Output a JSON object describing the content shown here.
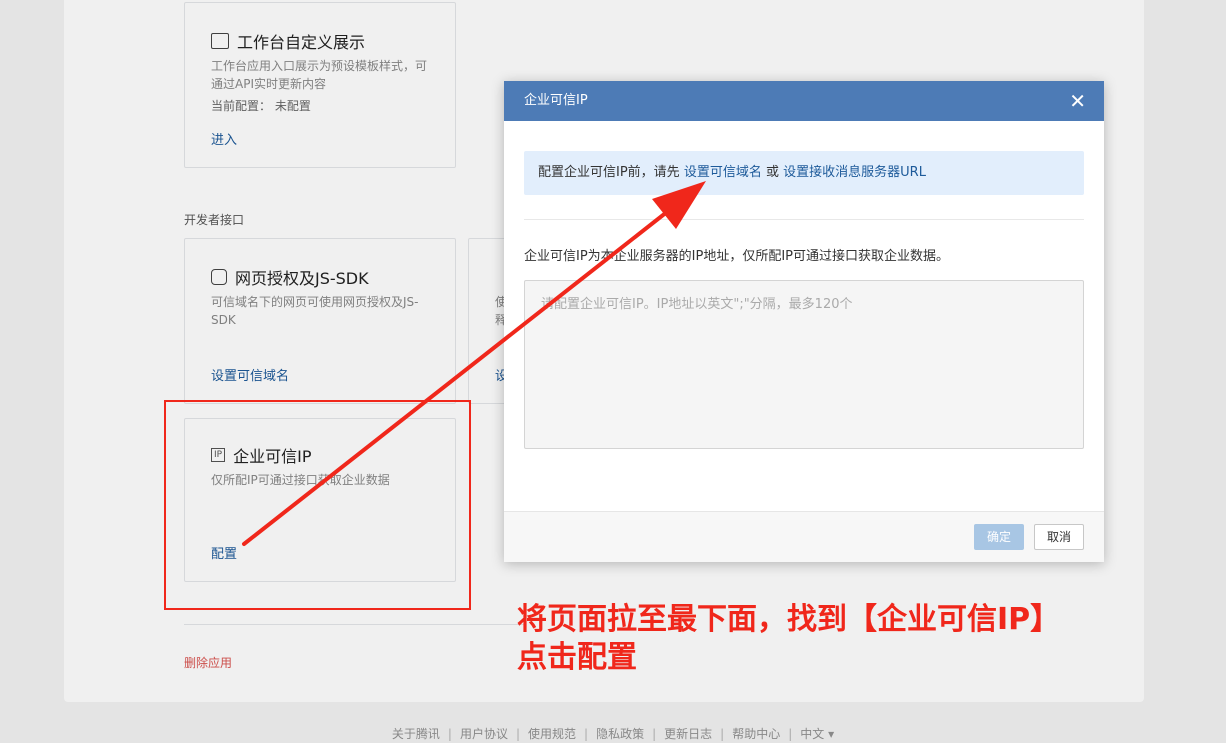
{
  "background": {
    "workbench_card": {
      "title": "工作台自定义展示",
      "desc_line1": "工作台应用入口展示为预设模板样式，可",
      "desc_line2": "通过API实时更新内容",
      "config_status": "当前配置：  未配置",
      "link": "进入"
    },
    "dev_section_label": "开发者接口",
    "webauth_card": {
      "title": "网页授权及JS-SDK",
      "desc_line1": "可信域名下的网页可使用网页授权及JS-",
      "desc_line2": "SDK",
      "link": "设置可信域名"
    },
    "partial_card": {
      "desc_line1": "使",
      "desc_line2": "释",
      "link": "设"
    },
    "trusted_ip_card": {
      "icon_text": "IP",
      "title": "企业可信IP",
      "desc": "仅所配IP可通过接口获取企业数据",
      "link": "配置"
    },
    "delete_app": "删除应用"
  },
  "footer": {
    "links": [
      "关于腾讯",
      "用户协议",
      "使用规范",
      "隐私政策",
      "更新日志",
      "帮助中心",
      "中文 ▾"
    ]
  },
  "modal": {
    "title": "企业可信IP",
    "close": "✕",
    "notice_prefix": "配置企业可信IP前，请先",
    "notice_link1": "设置可信域名",
    "notice_or": "或",
    "notice_link2": "设置接收消息服务器URL",
    "desc": "企业可信IP为本企业服务器的IP地址，仅所配IP可通过接口获取企业数据。",
    "input_placeholder": "请配置企业可信IP。IP地址以英文\";\"分隔，最多120个",
    "ok": "确定",
    "cancel": "取消"
  },
  "annotation": {
    "line1": "将页面拉至最下面，找到【企业可信IP】",
    "line2": "点击配置",
    "color": "#f0271b"
  }
}
